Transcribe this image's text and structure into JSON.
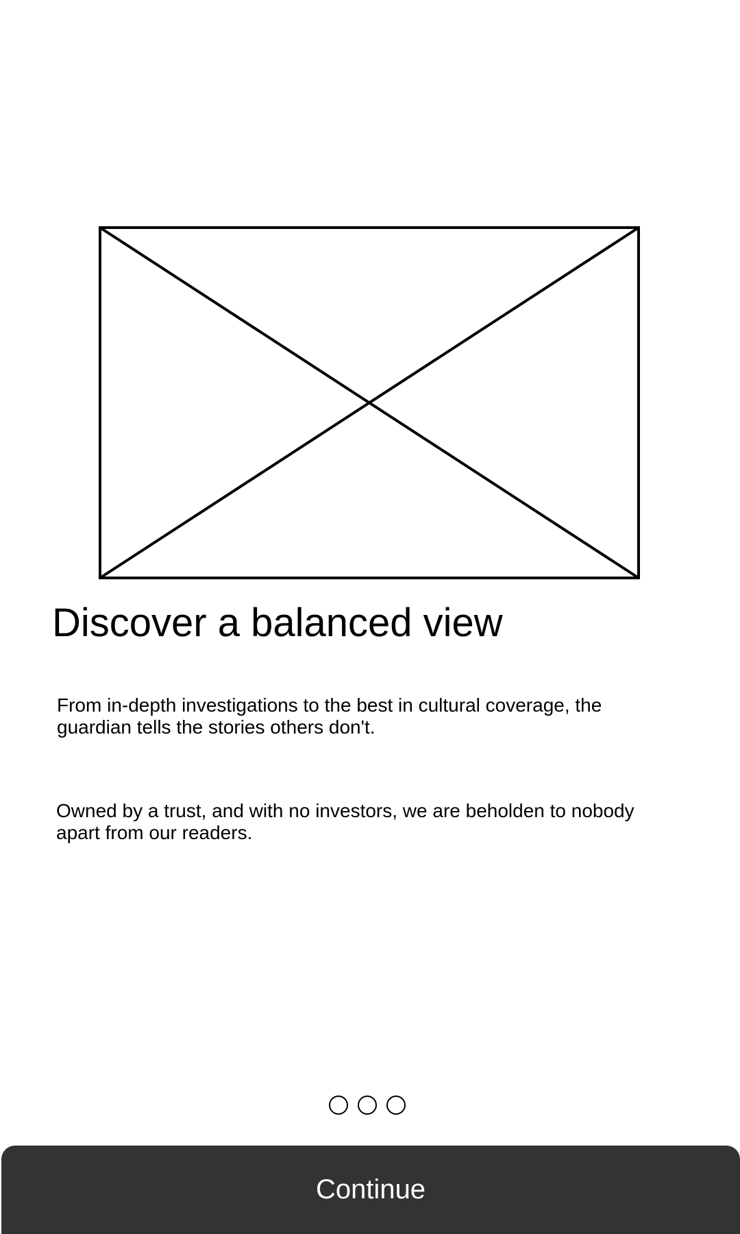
{
  "hero": {
    "image_icon": "image-placeholder-icon"
  },
  "headline": "Discover a balanced view",
  "paragraphs": {
    "p1": "From in-depth investigations to the best in cultural coverage, the guardian tells the stories others don't.",
    "p2": "Owned by a trust, and with no investors, we are beholden to nobody apart from our readers."
  },
  "pager": {
    "count": 3,
    "current": 1
  },
  "continue_button": {
    "label": "Continue"
  },
  "colors": {
    "background": "#ffffff",
    "text": "#000000",
    "button_background": "#333333",
    "button_text": "#ffffff"
  }
}
